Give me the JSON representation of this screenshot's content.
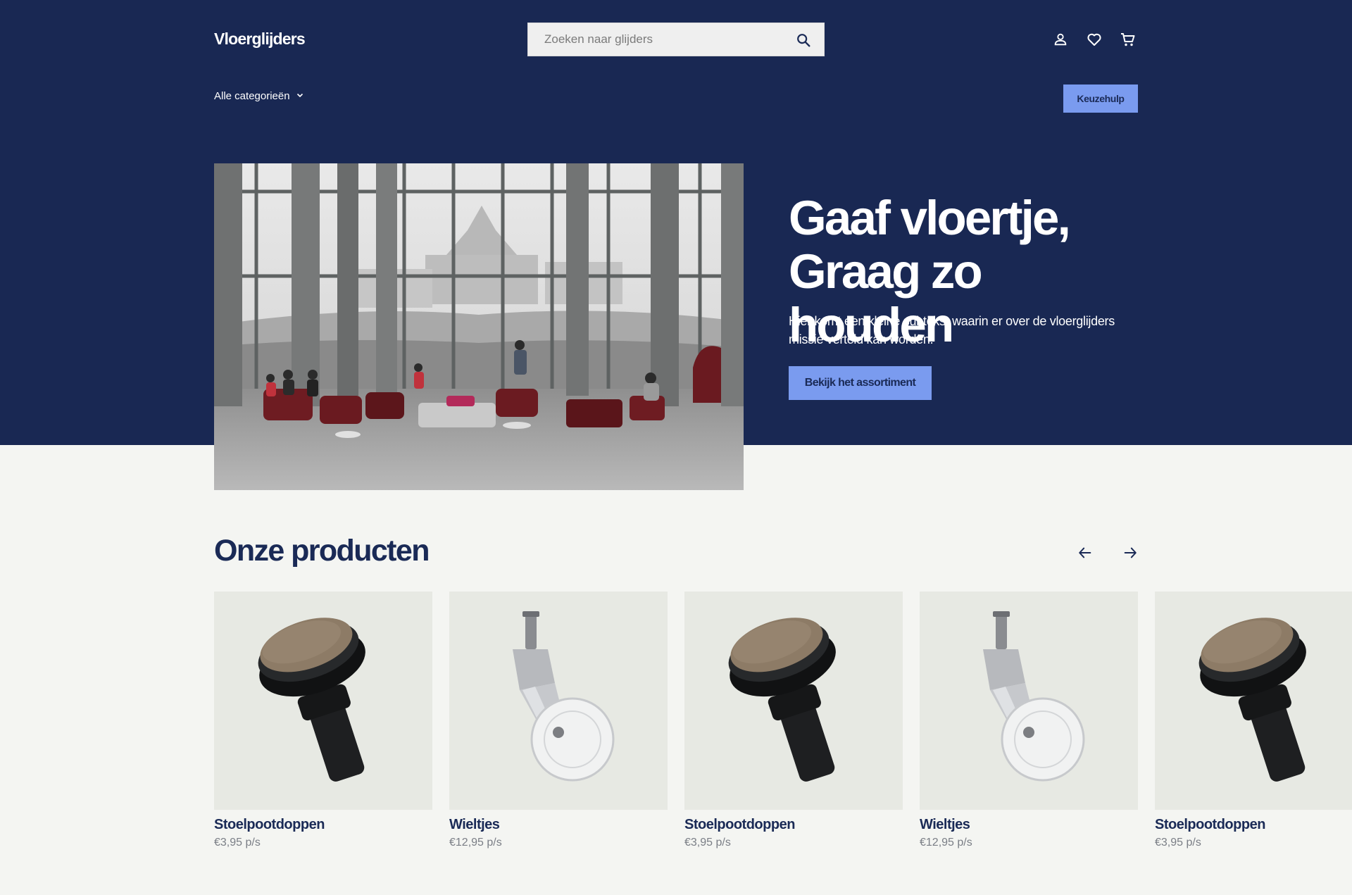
{
  "brand": {
    "logo_text": "Vloerglijders"
  },
  "search": {
    "placeholder": "Zoeken naar glijders"
  },
  "header": {
    "icons": [
      "user-icon",
      "heart-icon",
      "cart-icon"
    ]
  },
  "nav": {
    "categories_label": "Alle categorieën",
    "help_button": "Keuzehulp"
  },
  "hero": {
    "title_line1": "Gaaf vloertje,",
    "title_line2": "Graag zo houden",
    "subtitle": "Hier komt een kleine subtekst waarin er over de vloerglijders missie verteld kan worden.",
    "cta": "Bekijk het assortiment"
  },
  "products": {
    "section_title": "Onze producten",
    "items": [
      {
        "name": "Stoelpootdoppen",
        "price": "€3,95 p/s",
        "image": "felt-glider"
      },
      {
        "name": "Wieltjes",
        "price": "€12,95 p/s",
        "image": "caster-wheel"
      },
      {
        "name": "Stoelpootdoppen",
        "price": "€3,95 p/s",
        "image": "felt-glider"
      },
      {
        "name": "Wieltjes",
        "price": "€12,95 p/s",
        "image": "caster-wheel"
      },
      {
        "name": "Stoelpootdoppen",
        "price": "€3,95 p/s",
        "image": "felt-glider"
      }
    ]
  },
  "colors": {
    "navy": "#192853",
    "accent": "#7a9bef",
    "page_bg": "#f4f5f2",
    "card_bg": "#e7e9e3"
  }
}
